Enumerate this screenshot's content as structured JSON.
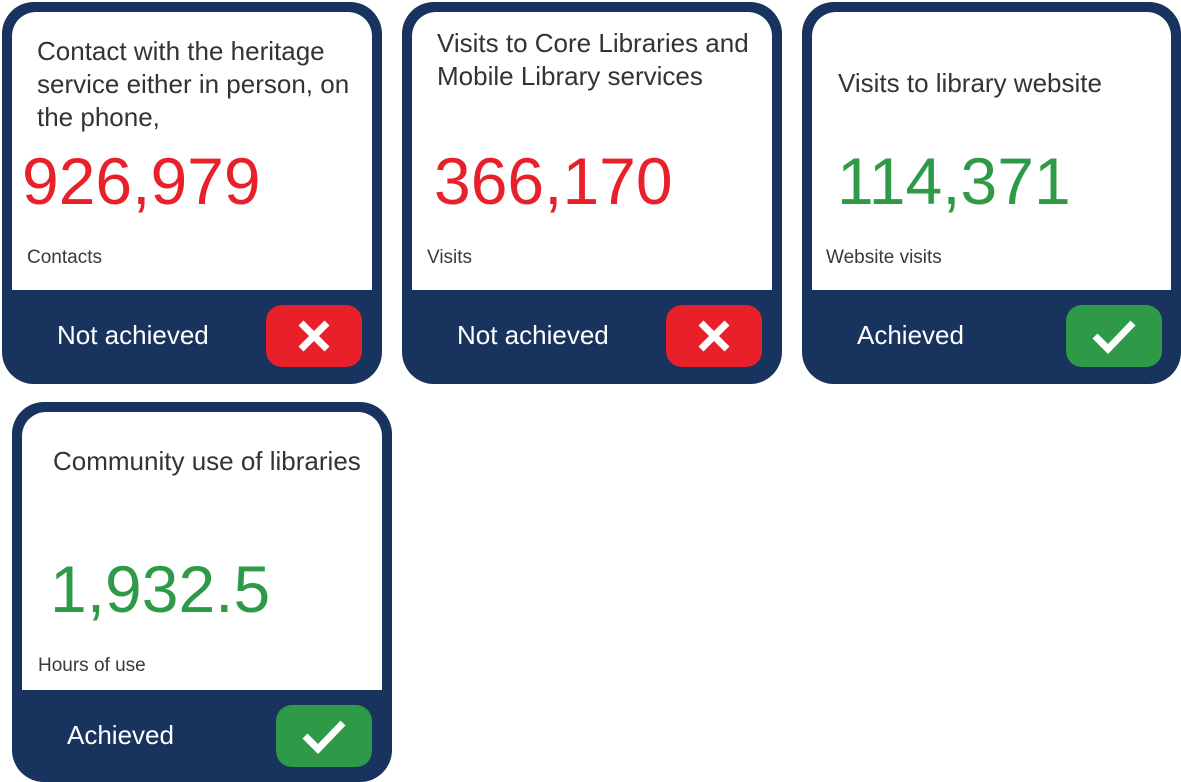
{
  "colors": {
    "navy": "#17335e",
    "red": "#e8202a",
    "green": "#2e9a47"
  },
  "cards": [
    {
      "title": "Contact with the heritage service either in person, on the phone,",
      "value": "926,979",
      "unit": "Contacts",
      "status": "Not achieved",
      "achieved": false,
      "icon": "cross-icon"
    },
    {
      "title": "Visits to Core Libraries and Mobile Library services",
      "value": "366,170",
      "unit": "Visits",
      "status": "Not achieved",
      "achieved": false,
      "icon": "cross-icon"
    },
    {
      "title": "Visits to library website",
      "value": "114,371",
      "unit": "Website visits",
      "status": "Achieved",
      "achieved": true,
      "icon": "check-icon"
    },
    {
      "title": "Community use of libraries",
      "value": "1,932.5",
      "unit": "Hours of use",
      "status": "Achieved",
      "achieved": true,
      "icon": "check-icon"
    }
  ]
}
